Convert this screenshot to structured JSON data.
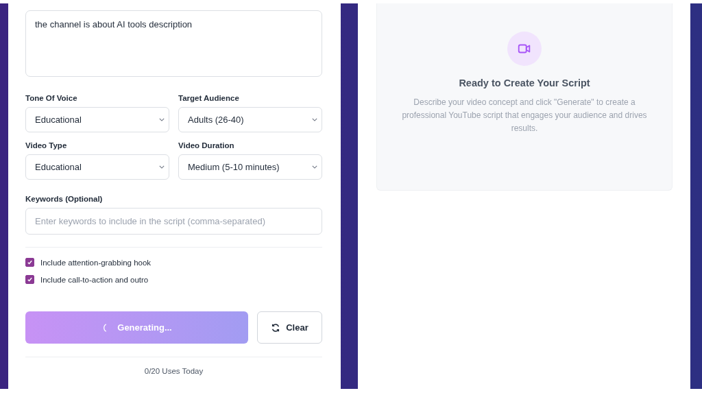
{
  "description": {
    "value": "the channel is about AI tools description"
  },
  "selects": [
    {
      "label": "Tone Of Voice",
      "value": "Educational"
    },
    {
      "label": "Target Audience",
      "value": "Adults (26-40)"
    },
    {
      "label": "Video Type",
      "value": "Educational"
    },
    {
      "label": "Video Duration",
      "value": "Medium (5-10 minutes)"
    }
  ],
  "keywords": {
    "label": "Keywords (Optional)",
    "placeholder": "Enter keywords to include in the script (comma-separated)"
  },
  "options": [
    {
      "label": "Include attention-grabbing hook",
      "checked": true
    },
    {
      "label": "Include call-to-action and outro",
      "checked": true
    }
  ],
  "generate_button": {
    "label": "Generating...",
    "loading": true
  },
  "clear_button": {
    "label": "Clear"
  },
  "usage": "0/20 Uses Today",
  "preview": {
    "title": "Ready to Create Your Script",
    "text": "Describe your video concept and click \"Generate\" to create a professional YouTube script that engages your audience and drives results."
  }
}
